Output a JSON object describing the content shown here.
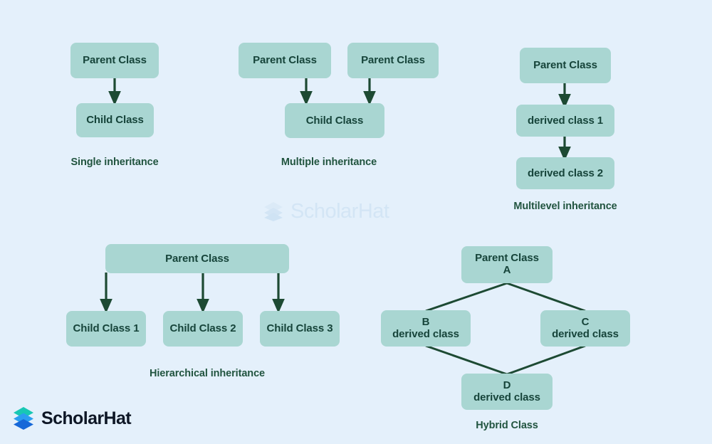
{
  "canvas": {
    "background_color": "#e4f0fb",
    "node_fill": "#a9d6d2",
    "node_text_color": "#16443a",
    "edge_color": "#1d4a33",
    "caption_color": "#21543f"
  },
  "watermark": {
    "text": "ScholarHat",
    "icon": "layers-icon",
    "color": "#d3e5f5"
  },
  "brand": {
    "text": "ScholarHat",
    "icon": "layers-icon",
    "text_color": "#0e1726",
    "icon_top_color": "#1fc8a9",
    "icon_mid_color": "#1f9bf0",
    "icon_bottom_color": "#1766d8"
  },
  "diagrams": [
    {
      "id": "single-inheritance",
      "caption": "Single inheritance",
      "nodes": [
        {
          "id": "single-parent",
          "label": "Parent Class"
        },
        {
          "id": "single-child",
          "label": "Child Class"
        }
      ]
    },
    {
      "id": "multiple-inheritance",
      "caption": "Multiple inheritance",
      "nodes": [
        {
          "id": "multiple-parent-1",
          "label": "Parent Class"
        },
        {
          "id": "multiple-parent-2",
          "label": "Parent Class"
        },
        {
          "id": "multiple-child",
          "label": "Child Class"
        }
      ]
    },
    {
      "id": "multilevel-inheritance",
      "caption": "Multilevel inheritance",
      "nodes": [
        {
          "id": "multilevel-parent",
          "label": "Parent Class"
        },
        {
          "id": "multilevel-derived-1",
          "label": "derived class 1"
        },
        {
          "id": "multilevel-derived-2",
          "label": "derived class 2"
        }
      ]
    },
    {
      "id": "hierarchical-inheritance",
      "caption": "Hierarchical inheritance",
      "nodes": [
        {
          "id": "hierarchical-parent",
          "label": "Parent Class"
        },
        {
          "id": "hierarchical-child-1",
          "label": "Child Class 1"
        },
        {
          "id": "hierarchical-child-2",
          "label": "Child Class 2"
        },
        {
          "id": "hierarchical-child-3",
          "label": "Child Class 3"
        }
      ]
    },
    {
      "id": "hybrid-inheritance",
      "caption": "Hybrid Class",
      "nodes": [
        {
          "id": "hybrid-parent-a",
          "line1": "Parent Class",
          "line2": "A"
        },
        {
          "id": "hybrid-derived-b",
          "line1": "B",
          "line2": "derived class"
        },
        {
          "id": "hybrid-derived-c",
          "line1": "C",
          "line2": "derived class"
        },
        {
          "id": "hybrid-derived-d",
          "line1": "D",
          "line2": "derived class"
        }
      ]
    }
  ],
  "labels": {
    "single_parent": "Parent Class",
    "single_child": "Child Class",
    "single_caption": "Single inheritance",
    "multiple_parent_1": "Parent Class",
    "multiple_parent_2": "Parent Class",
    "multiple_child": "Child Class",
    "multiple_caption": "Multiple inheritance",
    "multilevel_parent": "Parent Class",
    "multilevel_derived_1": "derived class 1",
    "multilevel_derived_2": "derived class 2",
    "multilevel_caption": "Multilevel inheritance",
    "hier_parent": "Parent Class",
    "hier_child_1": "Child Class 1",
    "hier_child_2": "Child Class 2",
    "hier_child_3": "Child Class 3",
    "hier_caption": "Hierarchical inheritance",
    "hybrid_a_line1": "Parent Class",
    "hybrid_a_line2": "A",
    "hybrid_b_line1": "B",
    "hybrid_b_line2": "derived class",
    "hybrid_c_line1": "C",
    "hybrid_c_line2": "derived class",
    "hybrid_d_line1": "D",
    "hybrid_d_line2": "derived class",
    "hybrid_caption": "Hybrid Class"
  }
}
